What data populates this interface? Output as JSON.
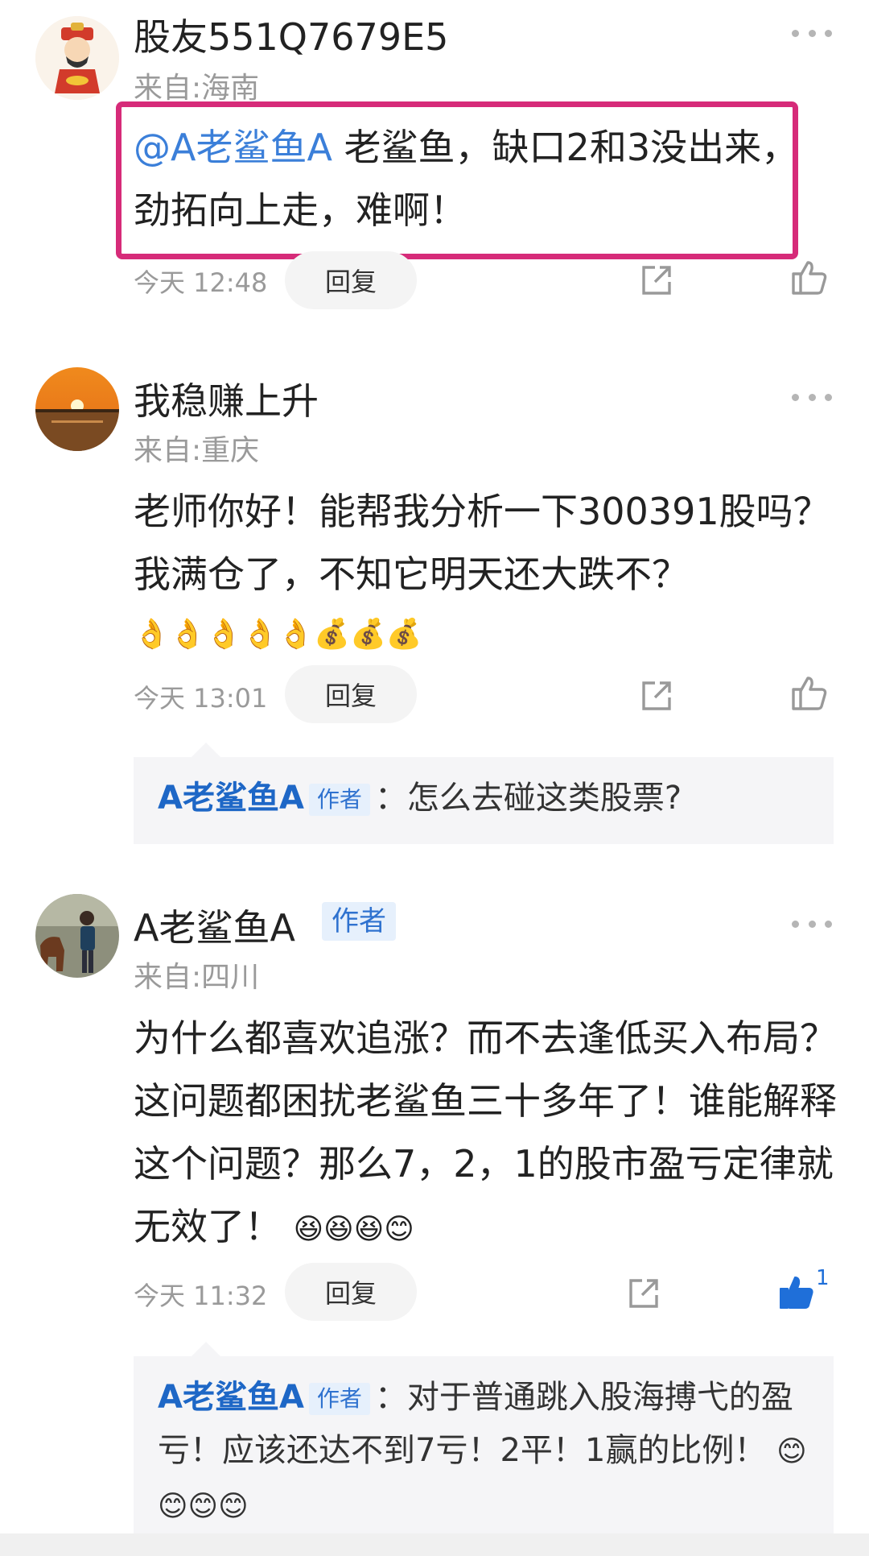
{
  "comments": [
    {
      "username": "股友551Q7679E5",
      "location": "来自:海南",
      "mention": "@A老鲨鱼A",
      "text": " 老鲨鱼，缺口2和3没出来，劲拓向上走，难啊！",
      "time": "今天 12:48",
      "reply_label": "回复"
    },
    {
      "username": "我稳赚上升",
      "location": "来自:重庆",
      "text": "老师你好！能帮我分析一下300391股吗？我满仓了，不知它明天还大跌不？",
      "emojis": [
        "👌",
        "👌",
        "👌",
        "👌",
        "👌",
        "💰",
        "💰",
        "💰"
      ],
      "time": "今天 13:01",
      "reply_label": "回复",
      "sub_reply": {
        "name": "A老鲨鱼A",
        "tag": "作者",
        "text": "：怎么去碰这类股票?"
      }
    },
    {
      "username": "A老鲨鱼A",
      "author_tag": "作者",
      "location": "来自:四川",
      "text": "为什么都喜欢追涨？而不去逢低买入布局？这问题都困扰老鲨鱼三十多年了！谁能解释这个问题？那么7，2，1的股市盈亏定律就无效了！",
      "emojis": [
        "😆",
        "😆",
        "😆",
        "😊"
      ],
      "time": "今天 11:32",
      "reply_label": "回复",
      "like_count": "1",
      "sub_reply": {
        "name": "A老鲨鱼A",
        "tag": "作者",
        "text": "：对于普通跳入股海搏弋的盈亏！应该还达不到7亏！2平！1赢的比例！",
        "emojis": [
          "😊",
          "😊",
          "😊",
          "😊"
        ]
      }
    }
  ],
  "colors": {
    "mention": "#3b7fd9",
    "highlight_border": "#d62b79",
    "like_active": "#1f6fd9",
    "sub_reply_bg": "#f5f5f7"
  }
}
